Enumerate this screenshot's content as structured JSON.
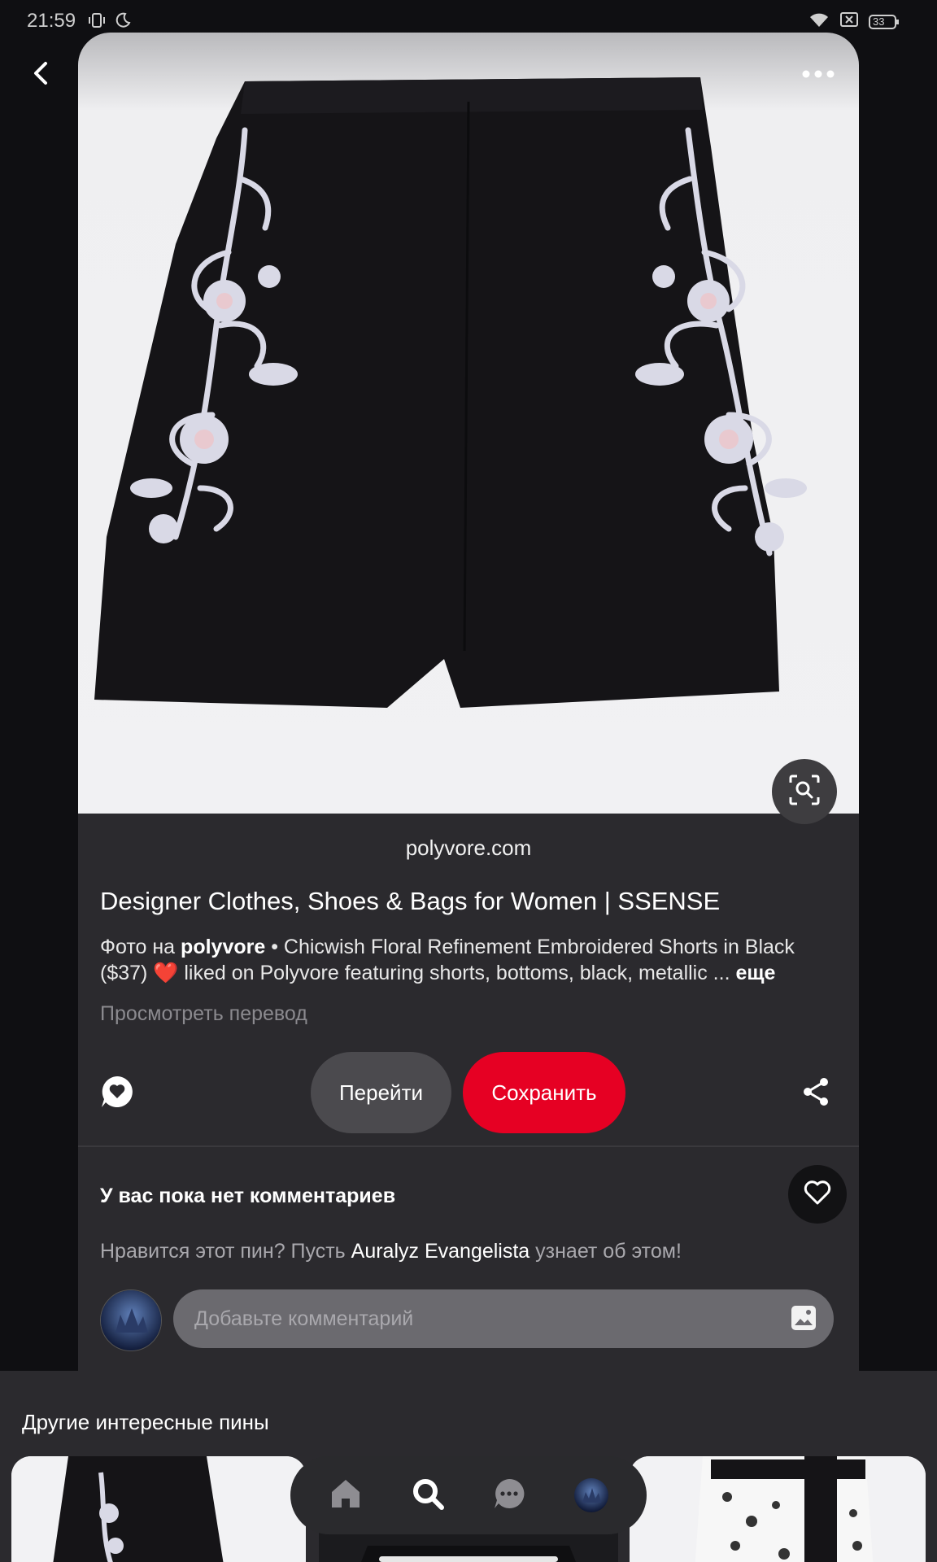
{
  "status_bar": {
    "time": "21:59",
    "battery": "33",
    "icons": [
      "vibrate-icon",
      "do-not-disturb-icon",
      "wifi-icon",
      "no-sim-icon",
      "battery-icon"
    ]
  },
  "pin": {
    "source": "polyvore.com",
    "title": "Designer Clothes, Shoes & Bags for Women | SSENSE",
    "description_prefix": "Фото на ",
    "description_source": "polyvore",
    "description_text": " • Chicwish Floral Refinement Embroidered Shorts in Black ($37) ❤️ liked on Polyvore featuring shorts, bottoms, black, metallic ... ",
    "description_more": "еще",
    "translate_label": "Просмотреть перевод"
  },
  "actions": {
    "go_label": "Перейти",
    "save_label": "Сохранить",
    "save_color": "#e60023"
  },
  "comments": {
    "empty_title": "У вас пока нет комментариев",
    "prompt_before": "Нравится этот пин? Пусть ",
    "prompt_name": "Auralyz Evangelista",
    "prompt_after": " узнает об этом!",
    "input_placeholder": "Добавьте комментарий"
  },
  "more_pins": {
    "title": "Другие интересные пины"
  },
  "bottom_nav": {
    "items": [
      "home-icon",
      "search-icon",
      "messages-icon",
      "profile-avatar"
    ],
    "active": "search-icon"
  }
}
